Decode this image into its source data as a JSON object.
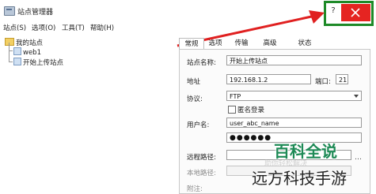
{
  "window": {
    "title": "站点管理器",
    "help": "?"
  },
  "menu": {
    "items": [
      "站点(S)",
      "选项(O)",
      "工具(T)",
      "帮助(H)"
    ]
  },
  "tree": {
    "root": "我的站点",
    "items": [
      "web1",
      "开始上传站点"
    ]
  },
  "tabs": [
    "常规",
    "选项",
    "传输",
    "高级",
    "状态"
  ],
  "form": {
    "site_name_label": "站点名称:",
    "site_name_value": "开始上传站点",
    "address_label": "地址",
    "address_value": "192.168.1.2",
    "port_label": "端口:",
    "port_value": "21",
    "protocol_label": "协议:",
    "protocol_value": "FTP",
    "anonymous_label": "匿名登录",
    "username_label": "用户名:",
    "username_value": "user_abc_name",
    "password_value": "●●●●●●",
    "remote_path_label": "远程路径:",
    "local_path_label": "本地路径:",
    "note_label": "附注:"
  },
  "watermark": {
    "baike": "百科全说",
    "sub": "助你轻松解决",
    "yuanfang": "远方科技手游"
  },
  "colors": {
    "close": "#e52421",
    "highlight": "#1e8a28",
    "arrow": "#e02020"
  }
}
